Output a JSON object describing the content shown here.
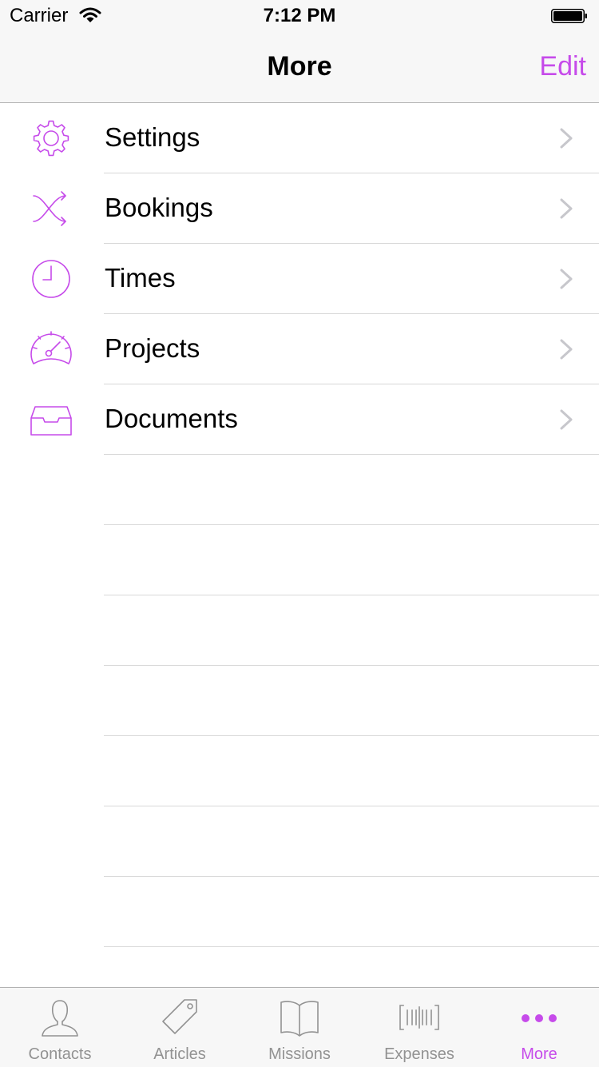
{
  "status_bar": {
    "carrier": "Carrier",
    "time": "7:12 PM"
  },
  "nav": {
    "title": "More",
    "edit_label": "Edit"
  },
  "colors": {
    "accent": "#c64bea",
    "inactive": "#929292",
    "separator": "#d8d8d8",
    "chevron": "#c7c7cc"
  },
  "list": {
    "items": [
      {
        "label": "Settings",
        "icon": "gear-icon"
      },
      {
        "label": "Bookings",
        "icon": "shuffle-icon"
      },
      {
        "label": "Times",
        "icon": "clock-icon"
      },
      {
        "label": "Projects",
        "icon": "speedometer-icon"
      },
      {
        "label": "Documents",
        "icon": "inbox-tray-icon"
      }
    ]
  },
  "tabs": [
    {
      "label": "Contacts",
      "icon": "person-icon",
      "active": false
    },
    {
      "label": "Articles",
      "icon": "tag-icon",
      "active": false
    },
    {
      "label": "Missions",
      "icon": "book-icon",
      "active": false
    },
    {
      "label": "Expenses",
      "icon": "barcode-icon",
      "active": false
    },
    {
      "label": "More",
      "icon": "more-dots-icon",
      "active": true
    }
  ]
}
